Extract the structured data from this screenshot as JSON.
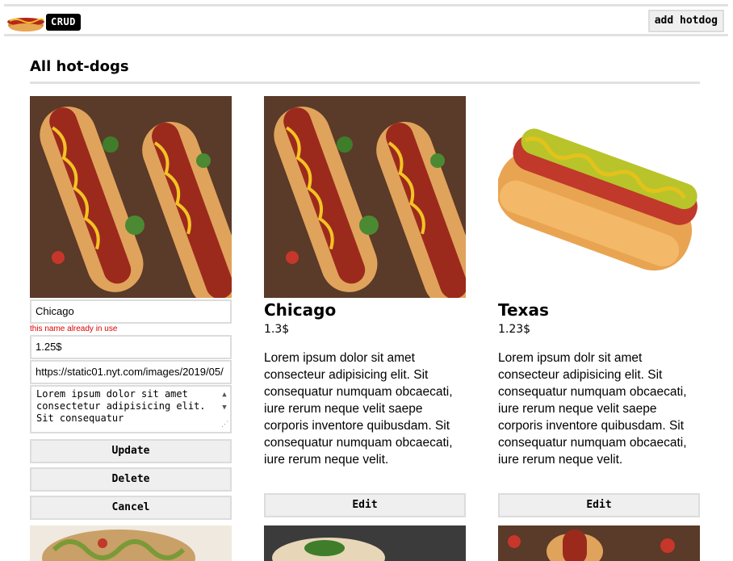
{
  "header": {
    "logo_icon": "hotdog-logo-icon",
    "badge": "CRUD",
    "add_button": "add hotdog"
  },
  "page": {
    "title": "All hot-dogs"
  },
  "edit_form": {
    "name_value": "Chicago",
    "name_error": "this name already in use",
    "price_value": "1.25$",
    "image_url_value": "https://static01.nyt.com/images/2019/05/",
    "description_value": "Lorem ipsum dolor sit amet consectetur adipisicing elit. Sit consequatur",
    "update_label": "Update",
    "delete_label": "Delete",
    "cancel_label": "Cancel"
  },
  "cards": [
    {
      "name": "Chicago",
      "price": "1.3$",
      "description": "Lorem ipsum dolor sit amet consecteur adipisicing elit. Sit consequatur numquam obcaecati, iure rerum neque velit saepe corporis inventore quibusdam. Sit consequatur numquam obcaecati, iure rerum neque velit.",
      "edit_label": "Edit"
    },
    {
      "name": "Texas",
      "price": "1.23$",
      "description": "Lorem ipsum dolr sit amet consecteur adipisicing elit. Sit consequatur numquam obcaecati, iure rerum neque velit saepe corporis inventore quibusdam. Sit consequatur numquam obcaecati, iure rerum neque velit.",
      "edit_label": "Edit"
    }
  ]
}
